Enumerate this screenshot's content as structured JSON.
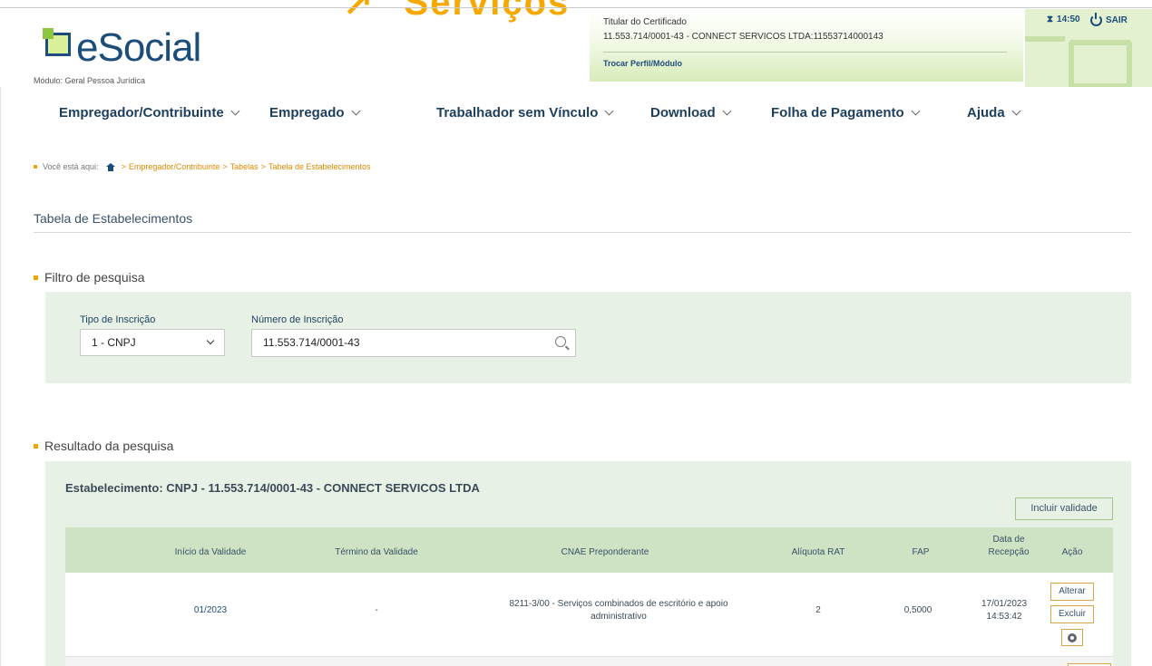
{
  "header": {
    "overlay_text": "Serviços",
    "overlay_arrow": "↗",
    "logo_text": "eSocial",
    "module_label": "Módulo: Geral Pessoa Jurídica",
    "certificate": {
      "title": "Titular do Certificado",
      "value": "11.553.714/0001-43 - CONNECT SERVICOS LTDA:11553714000143",
      "switch_link": "Trocar Perfil/Módulo"
    },
    "session_time": "14:50",
    "sair_label": "SAIR"
  },
  "nav": {
    "items": [
      {
        "label": "Empregador/Contribuinte"
      },
      {
        "label": "Empregado"
      },
      {
        "label": "Trabalhador sem Vínculo"
      },
      {
        "label": "Download"
      },
      {
        "label": "Folha de Pagamento"
      },
      {
        "label": "Ajuda"
      }
    ]
  },
  "breadcrumb": {
    "prefix": "Você está aqui:",
    "items": [
      "Empregador/Contribuinte",
      "Tabelas",
      "Tabela de Estabelecimentos"
    ],
    "separator": ">"
  },
  "page": {
    "title": "Tabela de Estabelecimentos"
  },
  "filter": {
    "heading": "Filtro de pesquisa",
    "tipo_label": "Tipo de Inscrição",
    "tipo_value": "1 - CNPJ",
    "numero_label": "Número de Inscrição",
    "numero_value": "11.553.714/0001-43"
  },
  "results": {
    "heading": "Resultado da pesquisa",
    "establishment": "Estabelecimento: CNPJ - 11.553.714/0001-43 - CONNECT SERVICOS LTDA",
    "incluir_label": "Incluir validade",
    "columns": {
      "inicio": "Início da Validade",
      "termino": "Término da Validade",
      "cnae": "CNAE Preponderante",
      "aliquota": "Alíquota RAT",
      "fap": "FAP",
      "data_line1": "Data de",
      "data_line2": "Recepção",
      "acao": "Ação"
    },
    "rows": [
      {
        "inicio": "01/2023",
        "termino": "-",
        "cnae_line1": "8211-3/00 - Serviços combinados de escritório e apoio",
        "cnae_line2": "administrativo",
        "aliquota": "2",
        "fap": "0,5000",
        "data_line1": "17/01/2023",
        "data_line2": "14:53:42",
        "alterar": "Alterar",
        "excluir": "Excluir"
      }
    ]
  },
  "colors": {
    "brand_blue": "#1c4d7a",
    "accent_orange": "#f5a800",
    "panel_green": "#e8f1e5",
    "header_green": "#cde3c4"
  }
}
